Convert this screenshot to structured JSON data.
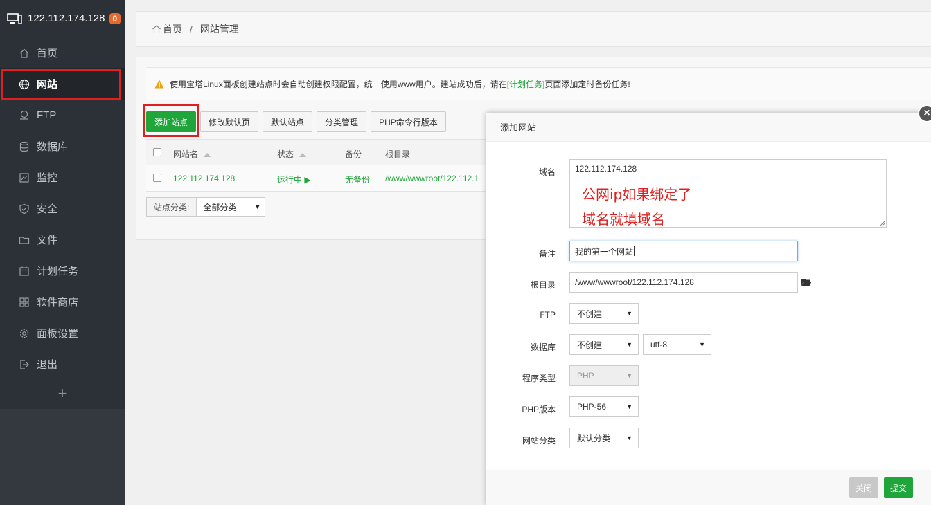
{
  "sidebar": {
    "server_ip": "122.112.174.128",
    "badge": "0",
    "items": [
      {
        "label": "首页",
        "icon": "home-icon"
      },
      {
        "label": "网站",
        "icon": "globe-icon"
      },
      {
        "label": "FTP",
        "icon": "ftp-icon"
      },
      {
        "label": "数据库",
        "icon": "database-icon"
      },
      {
        "label": "监控",
        "icon": "monitor-icon"
      },
      {
        "label": "安全",
        "icon": "shield-icon"
      },
      {
        "label": "文件",
        "icon": "folder-icon"
      },
      {
        "label": "计划任务",
        "icon": "calendar-icon"
      },
      {
        "label": "软件商店",
        "icon": "grid-icon"
      },
      {
        "label": "面板设置",
        "icon": "gear-icon"
      },
      {
        "label": "退出",
        "icon": "logout-icon"
      }
    ],
    "add_label": "+"
  },
  "breadcrumb": {
    "home": "首页",
    "sep": "/",
    "current": "网站管理"
  },
  "alert": {
    "text_before": "使用宝塔Linux面板创建站点时会自动创建权限配置，统一使用www用户。建站成功后，请在",
    "link": "[计划任务]",
    "text_after": "页面添加定时备份任务!"
  },
  "toolbar": {
    "add_site": "添加站点",
    "modify_default": "修改默认页",
    "default_site": "默认站点",
    "category_manage": "分类管理",
    "php_cli": "PHP命令行版本"
  },
  "table": {
    "headers": {
      "name": "网站名",
      "status": "状态",
      "backup": "备份",
      "root": "根目录"
    },
    "rows": [
      {
        "name": "122.112.174.128",
        "status": "运行中 ▶",
        "backup": "无备份",
        "root": "/www/wwwroot/122.112.1"
      }
    ]
  },
  "filter": {
    "label": "站点分类:",
    "value": "全部分类"
  },
  "dialog": {
    "title": "添加网站",
    "close": "×",
    "domain_label": "域名",
    "domain_value": "122.112.174.128",
    "annotation_line1": "公网ip如果绑定了",
    "annotation_line2": "域名就填域名",
    "remark_label": "备注",
    "remark_value": "我的第一个网站",
    "root_label": "根目录",
    "root_value": "/www/wwwroot/122.112.174.128",
    "ftp_label": "FTP",
    "ftp_value": "不创建",
    "db_label": "数据库",
    "db_value": "不创建",
    "db_charset": "utf-8",
    "program_label": "程序类型",
    "program_value": "PHP",
    "php_label": "PHP版本",
    "php_value": "PHP-56",
    "category_label": "网站分类",
    "category_value": "默认分类",
    "cancel": "关闭",
    "submit": "提交"
  },
  "colors": {
    "accent_green": "#20a53a",
    "highlight_red": "#e02020",
    "sidebar_bg": "#2c3138",
    "badge_orange": "#e8692c"
  }
}
